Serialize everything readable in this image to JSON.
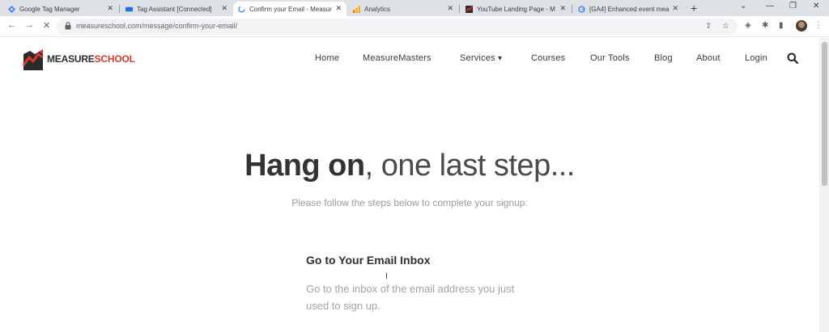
{
  "browser": {
    "tabs": [
      {
        "title": "Google Tag Manager",
        "icon": "gtm-icon"
      },
      {
        "title": "Tag Assistant [Connected]",
        "icon": "tag-assistant-icon"
      },
      {
        "title": "Confirm your Email - Measur",
        "icon": "loading-icon",
        "active": true
      },
      {
        "title": "Analytics",
        "icon": "analytics-icon"
      },
      {
        "title": "YouTube Landing Page - M",
        "icon": "measureschool-favicon"
      },
      {
        "title": "[GA4] Enhanced event mea",
        "icon": "google-icon"
      }
    ],
    "new_tab": "+",
    "url_host": "measureschool.com",
    "url_path": "/message/confirm-your-email/"
  },
  "site": {
    "logo_part1": "MEASURE",
    "logo_part2": "SCHOOL",
    "nav": [
      {
        "label": "Home"
      },
      {
        "label": "MeasureMasters"
      },
      {
        "label": "Services",
        "dropdown": true
      },
      {
        "label": "Courses"
      },
      {
        "label": "Our Tools"
      },
      {
        "label": "Blog"
      },
      {
        "label": "About"
      },
      {
        "label": "Login"
      }
    ],
    "dropdown_caret": "▾"
  },
  "content": {
    "headline_strong": "Hang on",
    "headline_rest": ", one last step...",
    "subheadline": "Please follow the steps below to complete your signup:",
    "step_title": "Go to Your Email Inbox",
    "step_text": "Go to the inbox of the email address you just used to sign up."
  },
  "colors": {
    "brand_red": "#d8392b",
    "brand_dark": "#2b2b2b",
    "tabstrip": "#dee1e6"
  }
}
